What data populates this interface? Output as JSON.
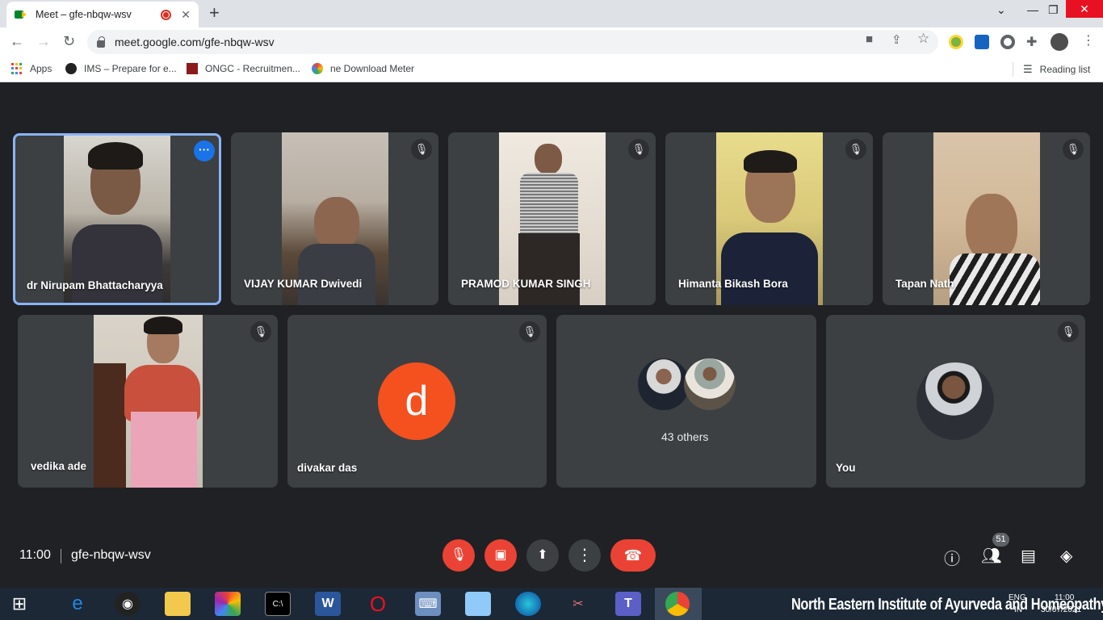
{
  "browser": {
    "tab_title": "Meet – gfe-nbqw-wsv",
    "tab_close": "✕",
    "new_tab": "+",
    "url": "meet.google.com/gfe-nbqw-wsv",
    "bookmarks": [
      {
        "label": "Apps",
        "icon": "apps-grid-icon"
      },
      {
        "label": "IMS – Prepare for e...",
        "icon": "ims-logo-icon"
      },
      {
        "label": "ONGC - Recruitmen...",
        "icon": "ongc-logo-icon"
      },
      {
        "label": "ne Download Meter",
        "icon": "download-meter-icon"
      }
    ],
    "reading_list": "Reading list"
  },
  "tiles": [
    {
      "name": "dr Nirupam Bhattacharyya",
      "active": true
    },
    {
      "name": "VIJAY KUMAR Dwivedi"
    },
    {
      "name": "PRAMOD KUMAR SINGH"
    },
    {
      "name": "Himanta Bikash Bora"
    },
    {
      "name": "Tapan Nath"
    },
    {
      "name": "vedika ade"
    },
    {
      "name": "divakar das",
      "avatar_letter": "d"
    },
    {
      "others": "43 others"
    },
    {
      "name": "You"
    }
  ],
  "meeting": {
    "time": "11:00",
    "code": "gfe-nbqw-wsv",
    "participants_count": "51"
  },
  "taskbar": {
    "watermark": "North Eastern Institute of Ayurveda and Homeopathy",
    "tray_lang": "ENG",
    "tray_region": "IN",
    "tray_time": "11:00",
    "tray_date": "30/07/2021"
  },
  "colors": {
    "meet_bg": "#202124",
    "tile_bg": "#3c4043",
    "active_border": "#8ab4f8",
    "red": "#ea4335",
    "divakar_avatar": "#f4511e"
  }
}
